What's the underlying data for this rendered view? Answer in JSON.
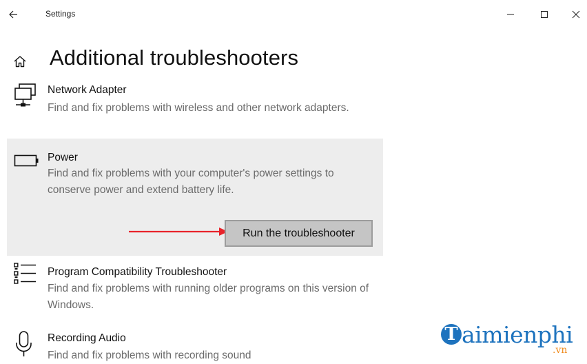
{
  "window": {
    "title": "Settings",
    "back_icon": "back-arrow-icon",
    "controls": [
      "minimize",
      "maximize",
      "close"
    ]
  },
  "page": {
    "title": "Additional troubleshooters",
    "home_icon": "home-icon"
  },
  "troubleshooters": [
    {
      "icon": "network-adapter-icon",
      "name": "Network Adapter",
      "description": "Find and fix problems with wireless and other network adapters."
    },
    {
      "icon": "battery-icon",
      "name": "Power",
      "description": "Find and fix problems with your computer's power settings to conserve power and extend battery life.",
      "selected": true,
      "action_label": "Run the troubleshooter"
    },
    {
      "icon": "list-icon",
      "name": "Program Compatibility Troubleshooter",
      "description": "Find and fix problems with running older programs on this version of Windows."
    },
    {
      "icon": "microphone-icon",
      "name": "Recording Audio",
      "description": "Find and fix problems with recording sound"
    }
  ],
  "annotation": {
    "arrow_color": "#e8232a"
  },
  "watermark": {
    "letter": "T",
    "text": "aimienphi",
    "suffix": ".vn",
    "brand_color": "#1e73be",
    "accent_color": "#f08a1b"
  }
}
